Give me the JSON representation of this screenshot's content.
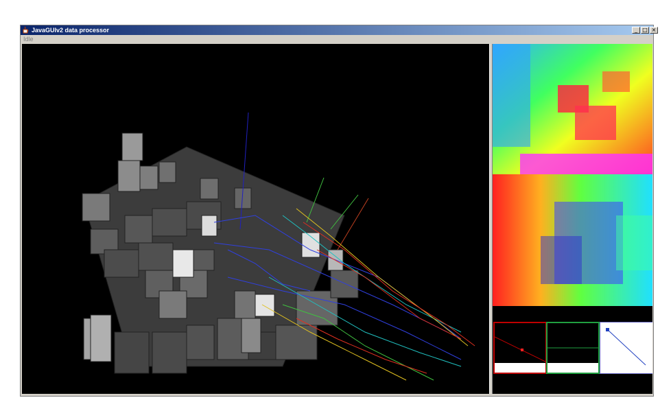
{
  "window": {
    "title": "JavaGUIv2 data processor",
    "buttons": {
      "minimize": "_",
      "maximize": "□",
      "close": "×"
    }
  },
  "status": {
    "text": "Idle"
  },
  "colors": {
    "title_start": "#0a246a",
    "title_end": "#a6caf0",
    "frame": "#d4d0c8",
    "viewport_bg": "#000000",
    "graph1_border": "#c00000",
    "graph2_border": "#20a040",
    "graph3_border": "#6060c0"
  },
  "icons": {
    "app": "java-cup-icon"
  }
}
